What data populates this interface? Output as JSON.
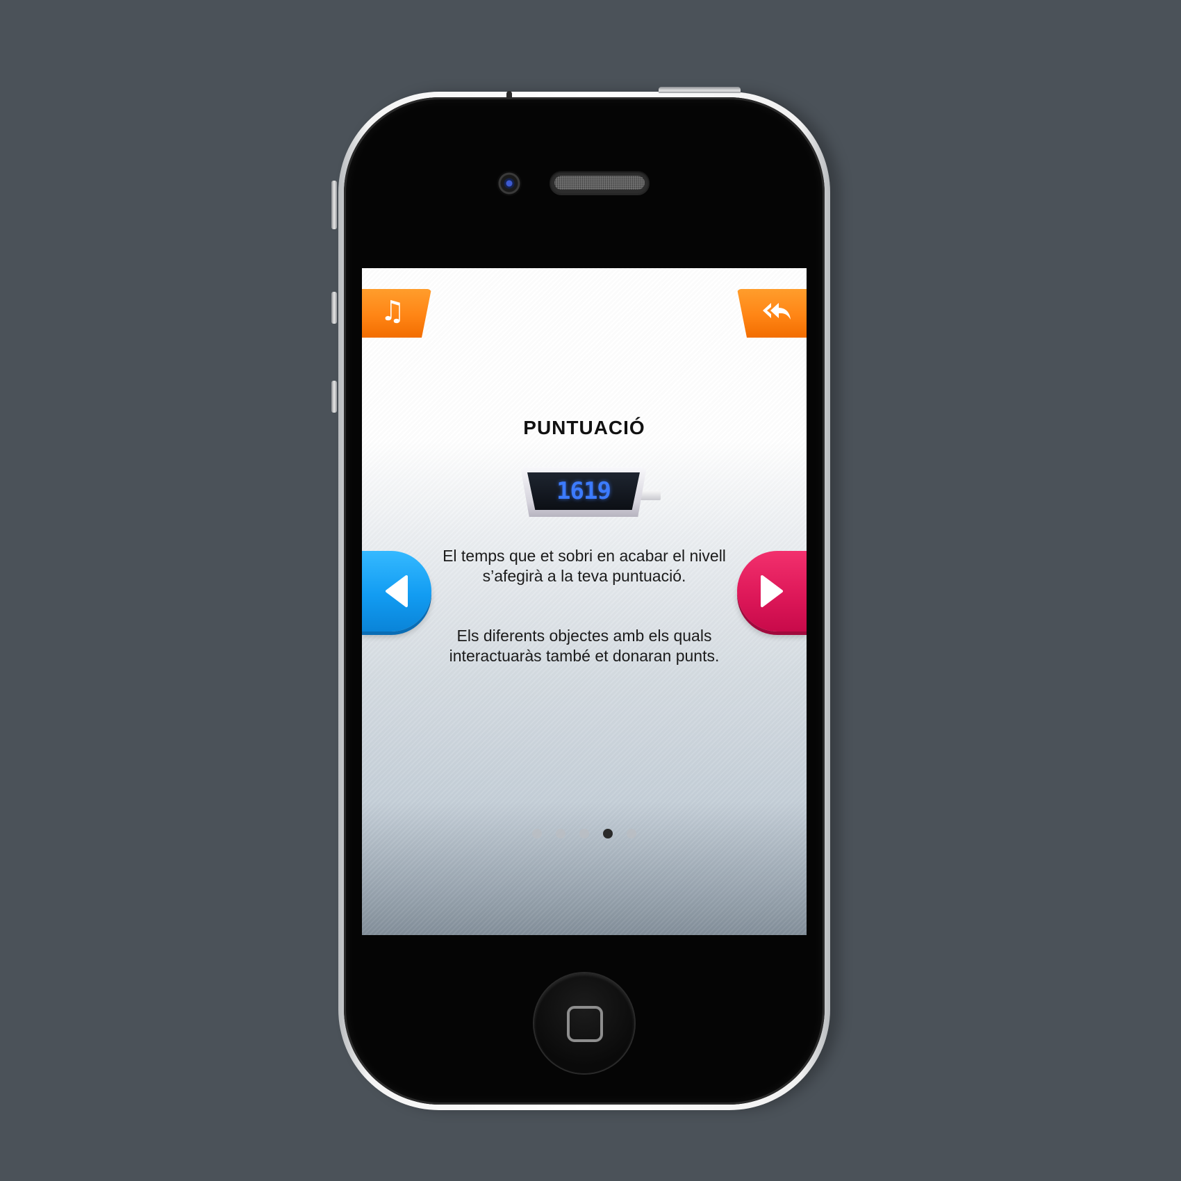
{
  "screen": {
    "title": "PUNTUACIÓ",
    "score_display": "1619",
    "paragraphs": [
      "El temps que et sobri en acabar el nivell s’afegirà a la teva puntuació.",
      "Els diferents objectes amb els quals interactuaràs també et donaran punts."
    ],
    "pagination": {
      "total": 5,
      "current": 4
    },
    "buttons": {
      "music": "music-icon",
      "back": "rewind-back-icon",
      "previous": "triangle-left-icon",
      "next": "triangle-right-icon"
    },
    "colors": {
      "orange": "#ff8515",
      "blue": "#129cf2",
      "pink": "#de1859",
      "score_digits": "#3c7bff",
      "background": "#4b5259"
    }
  }
}
